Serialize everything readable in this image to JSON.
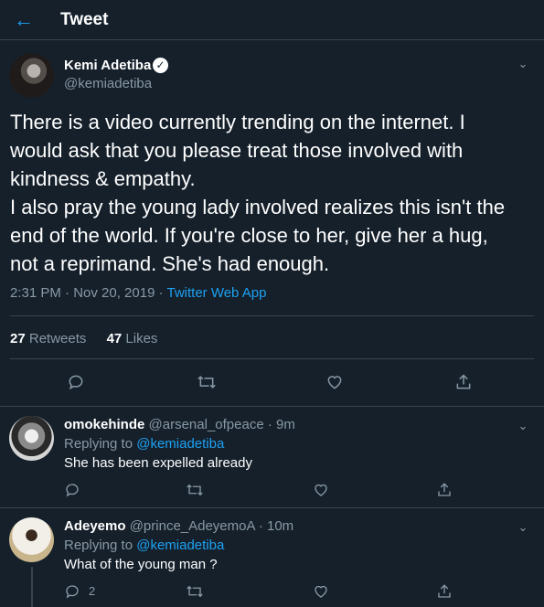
{
  "header": {
    "back_label": "←",
    "title": "Tweet"
  },
  "tweet": {
    "author_name": "Kemi Adetiba",
    "author_handle": "@kemiadetiba",
    "verified_mark": "✓",
    "text_lines": [
      "There is a video currently trending on the internet. I",
      "would ask that you please treat those involved with",
      "kindness & empathy.",
      "I also pray the young lady involved realizes this isn't the",
      "end of the world. If you're close to her, give her a hug,",
      "not a reprimand. She's had enough."
    ],
    "timestamp": "2:31 PM · Nov 20, 2019 · ",
    "source": "Twitter Web App",
    "retweets_count": "27",
    "retweets_label": " Retweets",
    "likes_count": "47",
    "likes_label": " Likes"
  },
  "replies": [
    {
      "name": "omokehinde",
      "handle_time": " @arsenal_ofpeace · 9m",
      "replying_prefix": "Replying to ",
      "replying_to": "@kemiadetiba",
      "text": "She has been expelled already"
    },
    {
      "name": "Adeyemo",
      "handle_time": " @prince_AdeyemoA · 10m",
      "replying_prefix": "Replying to ",
      "replying_to": "@kemiadetiba",
      "text": "What of the young man ?",
      "reply_count": "2"
    }
  ],
  "colors": {
    "background": "#15202b",
    "accent": "#1da1f2",
    "muted": "#8899a6",
    "border": "#38444d"
  },
  "icons": [
    "back-arrow-icon",
    "verified-badge-icon",
    "chevron-down-icon",
    "reply-icon",
    "retweet-icon",
    "like-icon",
    "share-icon"
  ]
}
